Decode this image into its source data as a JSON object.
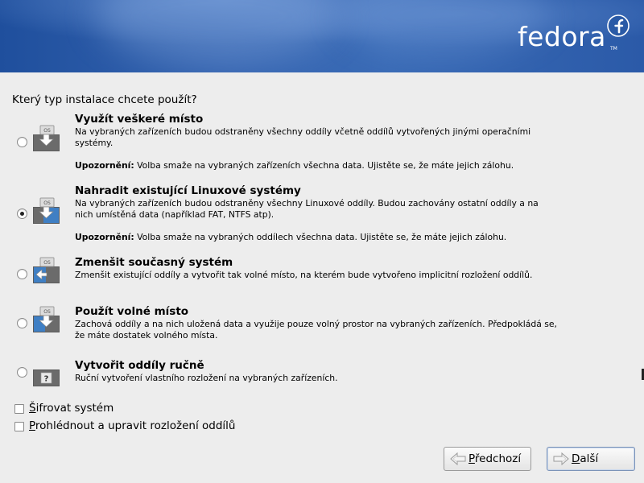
{
  "banner": {
    "logo_text": "fedora",
    "logo_tm": "TM"
  },
  "question": "Který typ instalace chcete použít?",
  "options": [
    {
      "title": "Využít veškeré místo",
      "description": "Na vybraných zařízeních budou odstraněny všechny oddíly včetně oddílů vytvořených jinými operačními systémy.",
      "warning_label": "Upozornění:",
      "warning_text": " Volba smaže na vybraných zařízeních všechna data. Ujistěte se, že máte jejich zálohu.",
      "selected": false,
      "icon": "disk-replace-all-icon"
    },
    {
      "title": "Nahradit existující Linuxové systémy",
      "description": "Na vybraných zařízeních budou odstraněny všechny Linuxové oddíly. Budou zachovány ostatní oddíly a na nich umístěná data (například FAT, NTFS atp).",
      "warning_label": "Upozornění:",
      "warning_text": " Volba smaže na vybraných oddílech všechna data. Ujistěte se, že máte jejich zálohu.",
      "selected": true,
      "icon": "disk-replace-linux-icon"
    },
    {
      "title": "Zmenšit současný systém",
      "description": "Zmenšit existující oddíly a vytvořit tak volné místo, na kterém bude vytvořeno implicitní rozložení oddílů.",
      "selected": false,
      "icon": "disk-shrink-icon"
    },
    {
      "title": "Použít volné místo",
      "description": "Zachová oddíly a na nich uložená data a využije pouze volný prostor na vybraných zařízeních. Předpokládá se, že máte dostatek volného místa.",
      "selected": false,
      "icon": "disk-free-space-icon"
    },
    {
      "title": "Vytvořit oddíly ručně",
      "description": "Ruční vytvoření vlastního rozložení na vybraných zařízeních.",
      "selected": false,
      "icon": "disk-custom-icon"
    }
  ],
  "checkboxes": [
    {
      "mnemonic": "Š",
      "rest": "ifrovat systém",
      "checked": false
    },
    {
      "mnemonic": "P",
      "rest": "rohlédnout a upravit rozložení oddílů",
      "checked": false
    }
  ],
  "buttons": {
    "back": {
      "mnemonic": "P",
      "rest": "ředchozí"
    },
    "next": {
      "mnemonic": "D",
      "rest": "alší"
    }
  },
  "colors": {
    "banner": "#2f5da8",
    "background": "#ededed",
    "disk_blue": "#3f7fc4"
  }
}
